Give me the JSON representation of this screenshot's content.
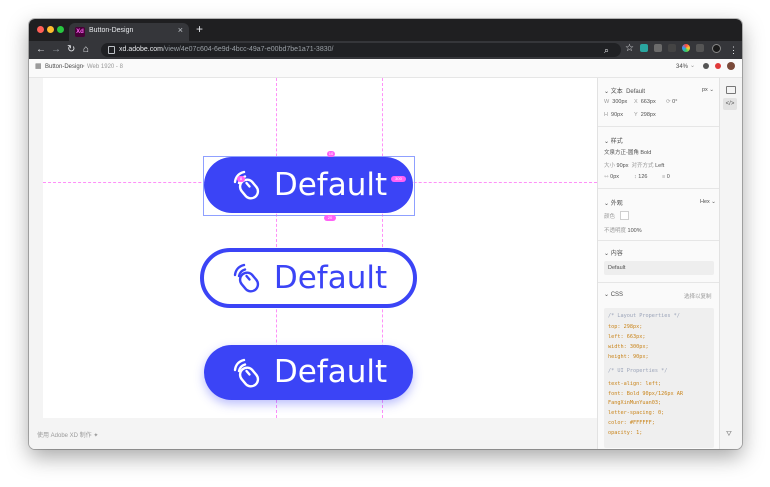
{
  "browser": {
    "tab_title": "Button-Design",
    "tab_favicon": "Xd",
    "tab_close": "×",
    "new_tab": "+",
    "url_host": "xd.adobe.com",
    "url_path": "/view/4e07c604-6e9d-4bcc-49a7-e00bd7be1a71-3830/",
    "traffic_colors": [
      "#ff5f57",
      "#febc2e",
      "#28c840"
    ]
  },
  "xd_header": {
    "breadcrumb_project": "Button-Design",
    "breadcrumb_sep": ">",
    "breadcrumb_artboard": "Web 1920 - 8",
    "zoom": "34%",
    "zoom_arrow": "⌄"
  },
  "canvas": {
    "buttons": [
      {
        "label": "Default",
        "style": "filled",
        "selected": true
      },
      {
        "label": "Default",
        "style": "outline",
        "selected": false
      },
      {
        "label": "Default",
        "style": "filled",
        "selected": false
      }
    ],
    "selection_handles": {
      "top": "10",
      "right": "300",
      "bottom": "20",
      "left": "8"
    },
    "footer_note": "使用 Adobe XD 制作 ",
    "accent": "#3b44f6",
    "guide_color": "#ff61f6"
  },
  "inspect": {
    "text_section": {
      "title": "文本",
      "value": "Default",
      "unit": "px",
      "w_label": "W",
      "w_value": "300px",
      "x_label": "X",
      "x_value": "663px",
      "rot": "0°",
      "h_label": "H",
      "h_value": "90px",
      "y_label": "Y",
      "y_value": "298px"
    },
    "style_section": {
      "title": "样式",
      "font": "文泉方正-圆角 Bold",
      "size_label": "大小",
      "size_value": "90px",
      "align_label": "对齐方式",
      "align_value": "Left",
      "spacing_1": "0px",
      "spacing_2": "126",
      "spacing_3": "0"
    },
    "appearance_section": {
      "title": "外观",
      "format": "Hex",
      "color_label": "颜色",
      "opacity_label": "不透明度",
      "opacity_value": "100%"
    },
    "content_section": {
      "title": "内容",
      "value": "Default"
    },
    "css_section": {
      "title": "CSS",
      "copy_label": "选择以复制",
      "lines": [
        {
          "text": "/* Layout Properties */",
          "kind": "comment"
        },
        {
          "text": "top: 298px;",
          "kind": "prop"
        },
        {
          "text": "left: 663px;",
          "kind": "prop"
        },
        {
          "text": "width: 300px;",
          "kind": "prop"
        },
        {
          "text": "height: 90px;",
          "kind": "prop"
        },
        {
          "text": "/* UI Properties */",
          "kind": "comment"
        },
        {
          "text": "text-align: left;",
          "kind": "prop"
        },
        {
          "text": "font: Bold 90px/126px AR",
          "kind": "prop"
        },
        {
          "text": "FangXinMunYuan03;",
          "kind": "prop"
        },
        {
          "text": "letter-spacing: 0;",
          "kind": "prop"
        },
        {
          "text": "color: #FFFFFF;",
          "kind": "prop"
        },
        {
          "text": "opacity: 1;",
          "kind": "prop"
        }
      ]
    }
  },
  "colors": {
    "accent": "#3b44f6",
    "comment": "#9aa3b8",
    "prop": "#c9841a"
  }
}
